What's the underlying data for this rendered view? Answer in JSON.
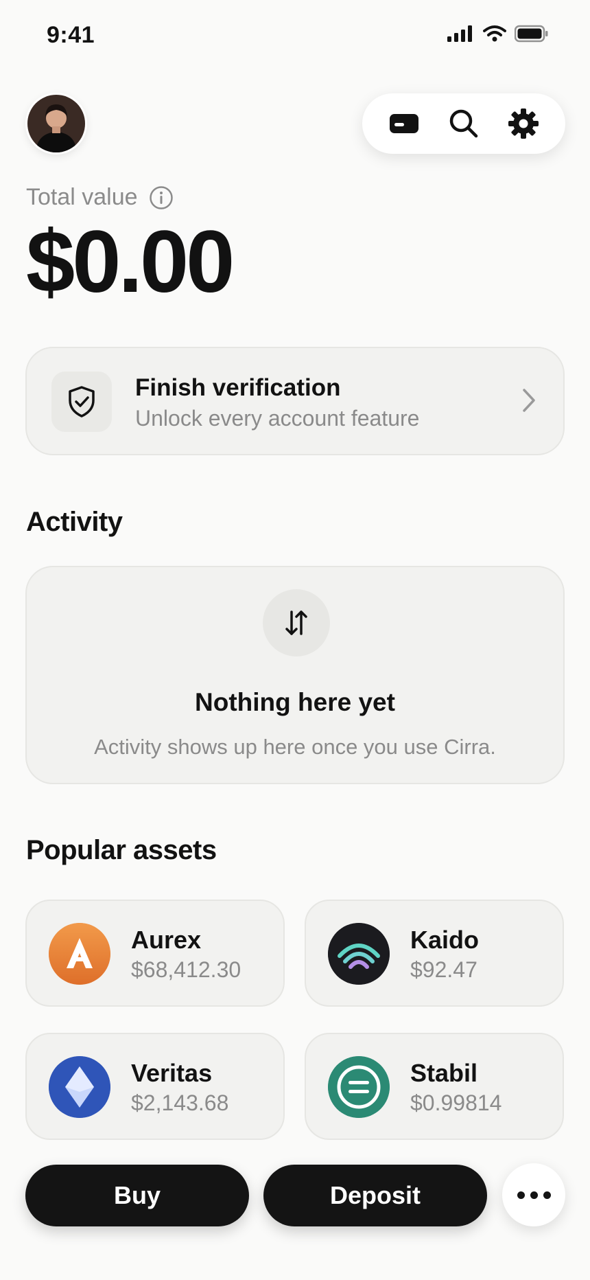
{
  "status_bar": {
    "time": "9:41",
    "icons": [
      "cellular-signal-icon",
      "wifi-icon",
      "battery-icon"
    ]
  },
  "header": {
    "avatar": "user-avatar",
    "toolbar_icons": [
      "card-icon",
      "search-icon",
      "gear-icon"
    ]
  },
  "balance": {
    "label": "Total value",
    "amount": "$0.00"
  },
  "verification": {
    "title": "Finish verification",
    "subtitle": "Unlock every account feature",
    "icon": "shield-check-icon"
  },
  "activity": {
    "heading": "Activity",
    "empty_title": "Nothing here yet",
    "empty_subtitle": "Activity shows up here once you use Cirra.",
    "icon": "swap-arrows-icon"
  },
  "popular_assets": {
    "heading": "Popular assets",
    "items": [
      {
        "name": "Aurex",
        "price": "$68,412.30",
        "color": "#e8833a"
      },
      {
        "name": "Kaido",
        "price": "$92.47",
        "color": "#1b1b1f"
      },
      {
        "name": "Veritas",
        "price": "$2,143.68",
        "color": "#2f55b8"
      },
      {
        "name": "Stabil",
        "price": "$0.99814",
        "color": "#2b8a74"
      }
    ]
  },
  "actions": {
    "buy_label": "Buy",
    "deposit_label": "Deposit",
    "more_icon": "more-dots-icon"
  },
  "colors": {
    "background": "#fafaf9",
    "card": "#f2f2f0",
    "primary_button": "#141414",
    "muted_text": "#8a8a8a"
  }
}
